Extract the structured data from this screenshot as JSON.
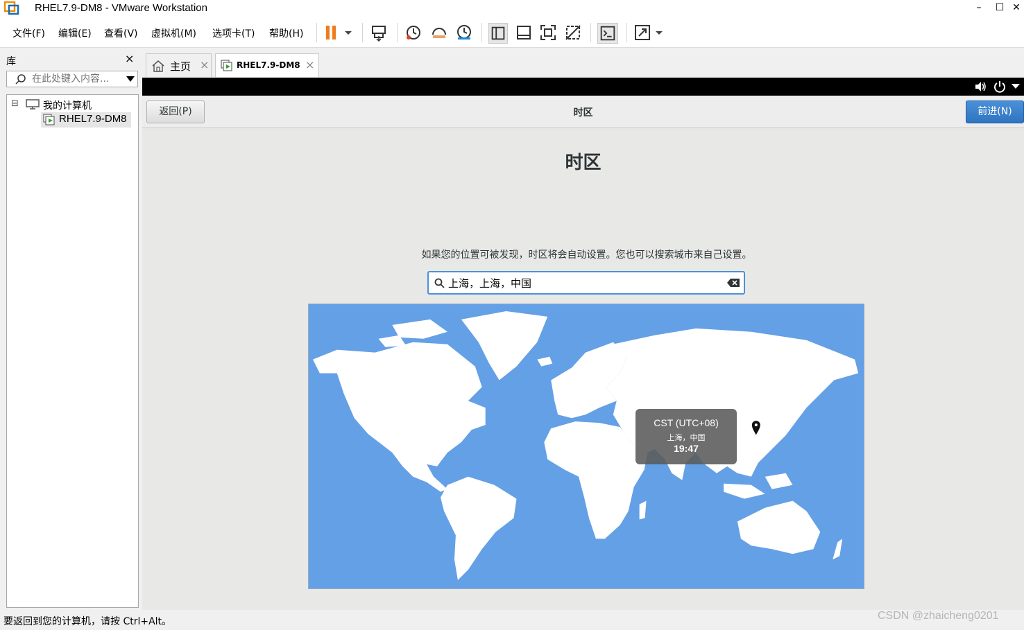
{
  "window": {
    "title": "RHEL7.9-DM8 - VMware Workstation",
    "min_glyph": "–",
    "max_glyph": "☐",
    "close_glyph": "✕"
  },
  "menu": {
    "items": [
      "文件(F)",
      "编辑(E)",
      "查看(V)",
      "虚拟机(M)",
      "选项卡(T)",
      "帮助(H)"
    ]
  },
  "toolbar": {
    "icons": [
      "pause-icon",
      "send-keys-icon",
      "snapshot-icon",
      "revert-snapshot-icon",
      "snapshot-manager-icon",
      "library-view-icon",
      "thumbnail-view-icon",
      "fullscreen-icon",
      "unity-icon",
      "console-icon",
      "stretch-icon"
    ]
  },
  "library": {
    "title": "库",
    "close_glyph": "×",
    "search_placeholder": "在此处键入内容...",
    "tree": {
      "root_label": "我的计算机",
      "expander": "⊟",
      "child_label": "RHEL7.9-DM8"
    }
  },
  "tabs": [
    {
      "label": "主页",
      "icon": "home-icon"
    },
    {
      "label": "RHEL7.9-DM8",
      "icon": "vm-running-icon"
    }
  ],
  "tab_close_glyph": "×",
  "installer": {
    "back_label": "返回(P)",
    "header_title": "时区",
    "next_label": "前进(N)",
    "main_title": "时区",
    "hint": "如果您的位置可被发现，时区将会自动设置。您也可以搜索城市来自己设置。",
    "search_value": "上海，上海，中国",
    "tooltip": {
      "zone": "CST (UTC+08)",
      "city": "上海，中国",
      "time": "19:47"
    },
    "colors": {
      "ocean": "#64a0e6",
      "land": "#ffffff",
      "accent": "#4a90d9"
    }
  },
  "status": {
    "text": "要返回到您的计算机，请按 Ctrl+Alt。",
    "watermark": "CSDN @zhaicheng0201"
  }
}
